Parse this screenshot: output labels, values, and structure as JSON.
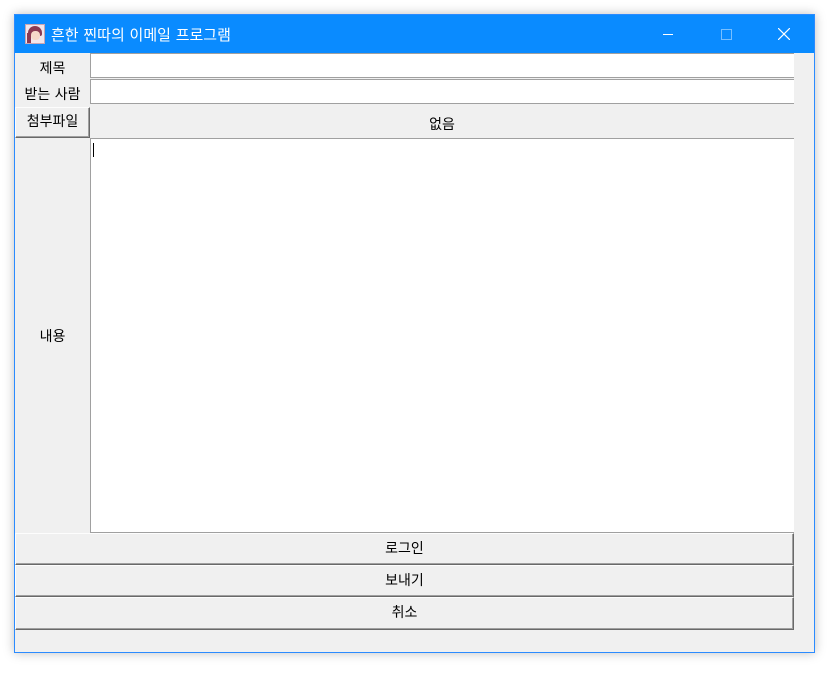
{
  "window": {
    "title": "흔한 찐따의 이메일 프로그램",
    "icon": "anime-girl-avatar-icon",
    "controls": [
      "minimize-icon",
      "maximize-icon",
      "close-icon"
    ]
  },
  "form": {
    "subject": {
      "label": "제목",
      "value": ""
    },
    "recipient": {
      "label": "받는 사람",
      "value": ""
    },
    "attachment": {
      "button_label": "첨부파일",
      "value": "없음"
    },
    "body": {
      "label": "내용",
      "value": ""
    }
  },
  "buttons": {
    "login": "로그인",
    "send": "보내기",
    "cancel": "취소"
  },
  "colors": {
    "titlebar": "#0a8bff",
    "window_bg": "#f0f0f0"
  }
}
